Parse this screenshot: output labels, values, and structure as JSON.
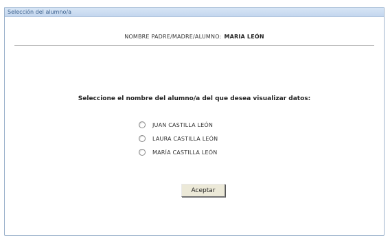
{
  "window": {
    "title": "Selección del alumno/a"
  },
  "parent": {
    "label": "NOMBRE PADRE/MADRE/ALUMNO:",
    "name": "MARIA LEÓN"
  },
  "prompt": "Seleccione el nombre del alumno/a del que desea visualizar datos:",
  "students": [
    {
      "label": "JUAN CASTILLA LEÓN",
      "selected": false
    },
    {
      "label": "LAURA CASTILLA LEÓN",
      "selected": false
    },
    {
      "label": "MARÍA CASTILLA LEÓN",
      "selected": false
    }
  ],
  "actions": {
    "accept_label": "Aceptar"
  }
}
